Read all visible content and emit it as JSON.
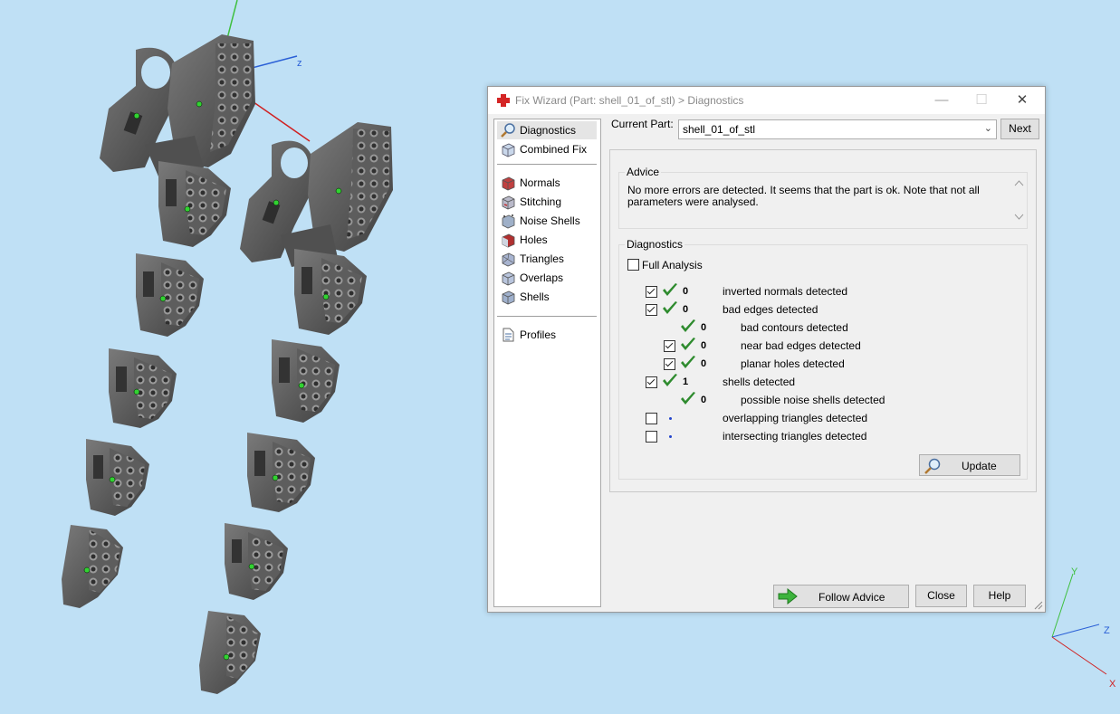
{
  "viewport": {
    "axis_labels": {
      "main_z": "z",
      "corner_y": "Y",
      "corner_z": "Z",
      "corner_x": "X"
    }
  },
  "dialog": {
    "title": "Fix Wizard (Part: shell_01_of_stl) > Diagnostics",
    "window_buttons": {
      "minimize": "—",
      "maximize": "☐",
      "close": "✕"
    },
    "nav": {
      "diagnostics": "Diagnostics",
      "combined_fix": "Combined Fix",
      "normals": "Normals",
      "stitching": "Stitching",
      "noise_shells": "Noise Shells",
      "holes": "Holes",
      "triangles": "Triangles",
      "overlaps": "Overlaps",
      "shells": "Shells",
      "profiles": "Profiles"
    },
    "current_part_label": "Current Part:",
    "current_part_value": "shell_01_of_stl",
    "next_button": "Next",
    "advice_title": "Advice",
    "advice_text": "No more errors are detected. It seems that the part is ok. Note that not all parameters were analysed.",
    "diagnostics_title": "Diagnostics",
    "full_analysis_label": "Full Analysis",
    "rows": {
      "inverted_normals": {
        "count": "0",
        "label": "inverted normals detected"
      },
      "bad_edges": {
        "count": "0",
        "label": "bad edges detected"
      },
      "bad_contours": {
        "count": "0",
        "label": "bad contours detected"
      },
      "near_bad_edges": {
        "count": "0",
        "label": "near bad edges detected"
      },
      "planar_holes": {
        "count": "0",
        "label": "planar holes detected"
      },
      "shells": {
        "count": "1",
        "label": "shells detected"
      },
      "noise_shells": {
        "count": "0",
        "label": "possible noise shells detected"
      },
      "overlapping": {
        "label": "overlapping triangles detected"
      },
      "intersecting": {
        "label": "intersecting triangles detected"
      }
    },
    "update_button": "Update",
    "follow_advice_button": "Follow Advice",
    "close_button": "Close",
    "help_button": "Help"
  }
}
